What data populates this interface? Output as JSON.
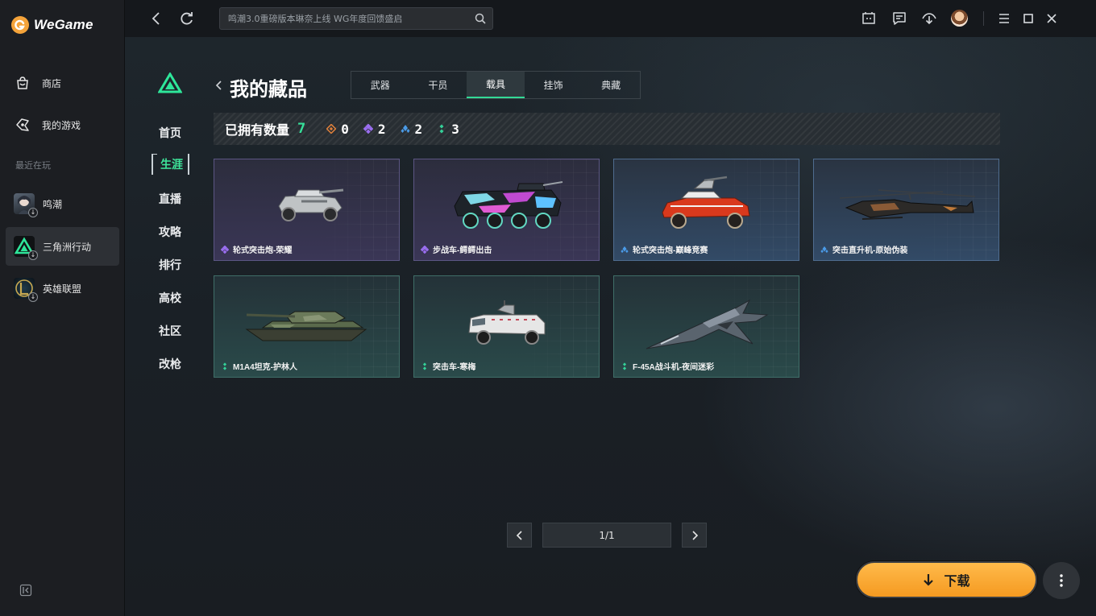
{
  "app": {
    "name": "WeGame"
  },
  "sidebar": {
    "nav": [
      {
        "label": "商店",
        "icon": "shop-bag-icon"
      },
      {
        "label": "我的游戏",
        "icon": "my-games-icon"
      }
    ],
    "recent_label": "最近在玩",
    "games": [
      {
        "label": "鸣潮",
        "icon": "wuthering-waves-icon",
        "active": false
      },
      {
        "label": "三角洲行动",
        "icon": "delta-force-icon",
        "active": true
      },
      {
        "label": "英雄联盟",
        "icon": "league-of-legends-icon",
        "active": false
      }
    ]
  },
  "topbar": {
    "search_placeholder": "鸣潮3.0重磅版本琳奈上线 WG年度回馈盛启",
    "icons": [
      "back-icon",
      "refresh-icon",
      "search-icon",
      "game-box-icon",
      "message-icon",
      "download-manager-icon",
      "avatar",
      "menu-icon",
      "minimize-icon",
      "close-icon"
    ]
  },
  "game_nav": {
    "items": [
      "首页",
      "生涯",
      "直播",
      "攻略",
      "排行",
      "高校",
      "社区",
      "改枪"
    ],
    "active": "生涯"
  },
  "page": {
    "title": "我的藏品",
    "tabs": [
      "武器",
      "干员",
      "载具",
      "挂饰",
      "典藏"
    ],
    "active_tab": "载具",
    "stats": {
      "label": "已拥有数量",
      "total": "7",
      "by_rarity": [
        {
          "rarity": "orange",
          "count": "0",
          "color": "#e0803a"
        },
        {
          "rarity": "purple",
          "count": "2",
          "color": "#9a6ef0"
        },
        {
          "rarity": "blue",
          "count": "2",
          "color": "#4a9be8"
        },
        {
          "rarity": "green",
          "count": "3",
          "color": "#34d199"
        }
      ]
    },
    "items": [
      {
        "name": "轮式突击炮-荣耀",
        "rarity": "purple"
      },
      {
        "name": "步战车-鳄鳄出击",
        "rarity": "purple"
      },
      {
        "name": "轮式突击炮-巅峰竞赛",
        "rarity": "blue"
      },
      {
        "name": "突击直升机-原始伪装",
        "rarity": "blue"
      },
      {
        "name": "M1A4坦克-护林人",
        "rarity": "green"
      },
      {
        "name": "突击车-寒梅",
        "rarity": "green"
      },
      {
        "name": "F-45A战斗机-夜间迷彩",
        "rarity": "green"
      }
    ],
    "pagination": {
      "text": "1/1"
    }
  },
  "actions": {
    "download_label": "下载"
  }
}
